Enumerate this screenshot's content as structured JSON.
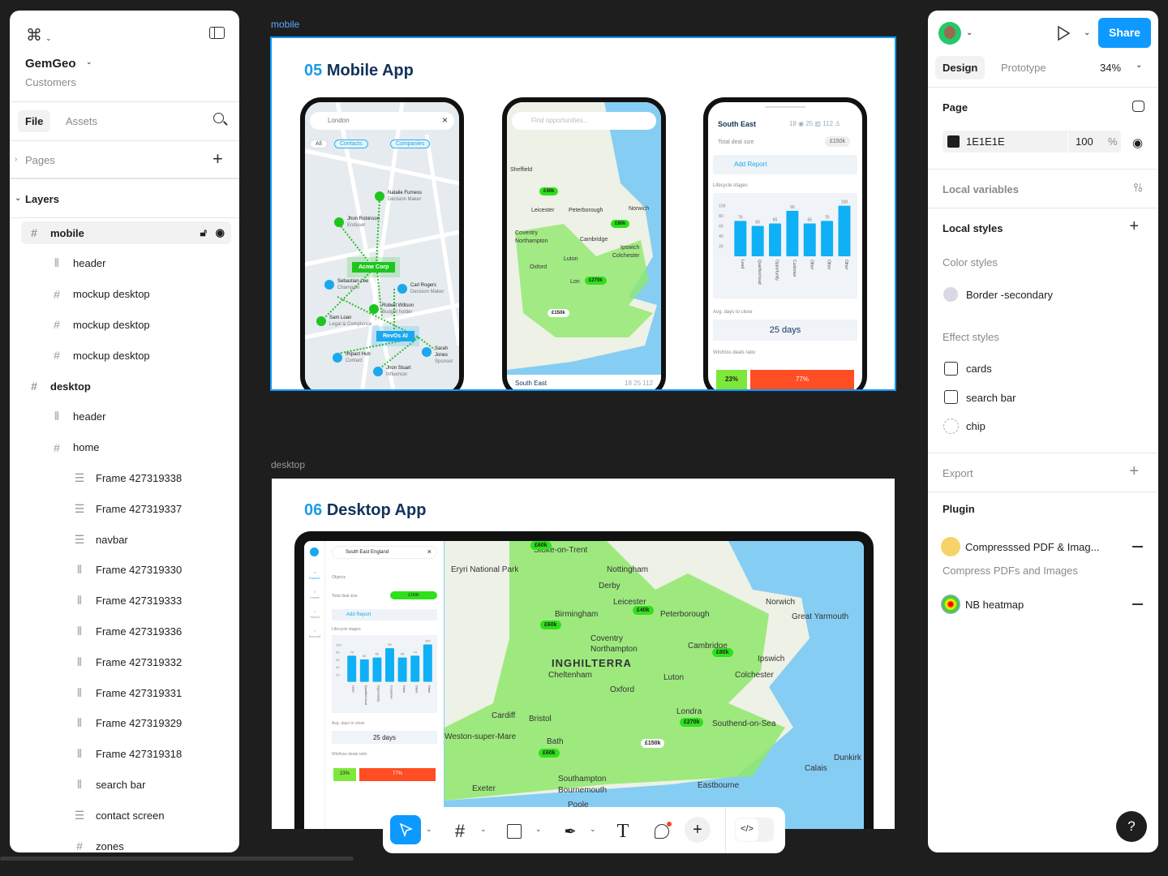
{
  "left_panel": {
    "project_name": "GemGeo",
    "project_sub": "Customers",
    "tabs": [
      "File",
      "Assets"
    ],
    "pages_label": "Pages",
    "layers_label": "Layers",
    "layers": [
      {
        "name": "mobile",
        "icon": "frame-icon",
        "level": 0,
        "selected": true
      },
      {
        "name": "header",
        "icon": "columns-icon",
        "level": 1
      },
      {
        "name": "mockup desktop",
        "icon": "frame-icon",
        "level": 1
      },
      {
        "name": "mockup desktop",
        "icon": "frame-icon",
        "level": 1
      },
      {
        "name": "mockup desktop",
        "icon": "frame-icon",
        "level": 1
      },
      {
        "name": "desktop",
        "icon": "frame-icon",
        "level": 0
      },
      {
        "name": "header",
        "icon": "columns-icon",
        "level": 1
      },
      {
        "name": "home",
        "icon": "frame-icon",
        "level": 1
      },
      {
        "name": "Frame 427319338",
        "icon": "rows-icon",
        "level": 2
      },
      {
        "name": "Frame 427319337",
        "icon": "rows-icon",
        "level": 2
      },
      {
        "name": "navbar",
        "icon": "rows-icon",
        "level": 2
      },
      {
        "name": "Frame 427319330",
        "icon": "columns-icon",
        "level": 2
      },
      {
        "name": "Frame 427319333",
        "icon": "columns-icon",
        "level": 2
      },
      {
        "name": "Frame 427319336",
        "icon": "columns-icon",
        "level": 2
      },
      {
        "name": "Frame 427319332",
        "icon": "columns-icon",
        "level": 2
      },
      {
        "name": "Frame 427319331",
        "icon": "columns-icon",
        "level": 2
      },
      {
        "name": "Frame 427319329",
        "icon": "columns-icon",
        "level": 2
      },
      {
        "name": "Frame 427319318",
        "icon": "columns-icon",
        "level": 2
      },
      {
        "name": "search bar",
        "icon": "columns-icon",
        "level": 2
      },
      {
        "name": "contact screen",
        "icon": "rows-icon",
        "level": 2
      },
      {
        "name": "zones",
        "icon": "frame-icon",
        "level": 2
      }
    ]
  },
  "right_panel": {
    "share_label": "Share",
    "tabs": [
      "Design",
      "Prototype"
    ],
    "zoom": "34%",
    "page_label": "Page",
    "page_color": "1E1E1E",
    "page_color_hex": "#1E1E1E",
    "page_opacity": "100",
    "percent": "%",
    "local_variables": "Local variables",
    "local_styles": "Local styles",
    "color_styles": "Color styles",
    "color_style_items": [
      {
        "name": "Border -secondary",
        "color": "#d9d9e3"
      }
    ],
    "effect_styles": "Effect styles",
    "effect_items": [
      "cards",
      "search bar",
      "chip"
    ],
    "export": "Export",
    "plugin": "Plugin",
    "plugins": [
      {
        "name": "Compresssed PDF & Imag...",
        "desc": "Compress PDFs and Images"
      },
      {
        "name": "NB heatmap",
        "desc": ""
      }
    ]
  },
  "canvas": {
    "mobile_frame_label": "mobile",
    "desktop_frame_label": "desktop",
    "mobile": {
      "num": "05",
      "title": "Mobile App",
      "phone1": {
        "search": "London",
        "chips": [
          "All",
          "Contacts",
          "Companies"
        ],
        "contacts": [
          {
            "name": "Natalie Furness",
            "role": "Decision Maker",
            "color": "green"
          },
          {
            "name": "Jhon Robinson",
            "role": "Enduser",
            "color": "green"
          },
          {
            "name": "Sebastian Lee",
            "role": "Champion",
            "color": "blue"
          },
          {
            "name": "Carl Rogers",
            "role": "Decision Maker",
            "color": "blue"
          },
          {
            "name": "Robert Willson",
            "role": "Budget holder",
            "color": "green"
          },
          {
            "name": "Sam Loan",
            "role": "Legal & Complence",
            "color": "green"
          },
          {
            "name": "Impact Hub",
            "role": "Contact",
            "color": "blue"
          },
          {
            "name": "Jhon Stuart",
            "role": "Influencer",
            "color": "blue"
          },
          {
            "name": "Sarah Jones",
            "role": "Sponsor",
            "color": "blue"
          }
        ],
        "companies": [
          "Acme Corp",
          "RevOs AI"
        ]
      },
      "phone2": {
        "search_placeholder": "Find opportunities...",
        "places": [
          "Sheffield",
          "Leicester",
          "Peterborough",
          "Norwich",
          "Coventry",
          "Northampton",
          "Cambridge",
          "Ipswich",
          "Colchester",
          "Luton",
          "Oxford",
          "Lon"
        ],
        "badges": [
          "£40k",
          "£80k",
          "£270k",
          "£150k"
        ],
        "footer_region": "South East",
        "footer_stats": "18  25  112"
      },
      "phone3": {
        "region": "South East",
        "stats": [
          "18",
          "25",
          "112"
        ],
        "deal_label": "Total deal size",
        "deal_value": "£150k",
        "add_report": "Add Report",
        "lifecycle_label": "Lifecycle stages",
        "avg_label": "Avg. days to close",
        "avg_value": "25 days",
        "ratio_label": "Win/loss deals ratio",
        "win": "23%",
        "loss": "77%",
        "win_fraction": 0.23
      }
    },
    "desktop": {
      "num": "06",
      "title": "Desktop App",
      "search": "South East England",
      "nav": [
        "Explore",
        "Create",
        "Saved",
        "Account"
      ],
      "objects_label": "Objects",
      "deal_label": "Total deal size",
      "deal_value": "£150k",
      "add_report": "Add Report",
      "lifecycle_label": "Lifecycle stages",
      "avg_label": "Avg. days to close",
      "avg_value": "25 days",
      "ratio_label": "Win/loss deals ratio",
      "win": "23%",
      "loss": "77%",
      "places": [
        "Stoke-on-Trent",
        "Nottingham",
        "Derby",
        "Leicester",
        "Birmingham",
        "Peterborough",
        "Norwich",
        "Great Yarmouth",
        "Coventry",
        "Northampton",
        "Cambridge",
        "INGHILTERRA",
        "Ipswich",
        "Cheltenham",
        "Luton",
        "Colchester",
        "Oxford",
        "Londra",
        "Cardiff",
        "Bristol",
        "Southend-on-Sea",
        "Weston-super-Mare",
        "Bath",
        "Southampton",
        "Bournemouth",
        "Poole",
        "Exeter",
        "Eastbourne",
        "Calais",
        "Dunkirk",
        "Eryri National Park"
      ],
      "badges": [
        "£60k",
        "£40k",
        "£60k",
        "£80k",
        "£270k",
        "£150k",
        "£60k"
      ]
    },
    "lifecycle_chart": {
      "type": "bar",
      "categories": [
        "Lead",
        "Qualified lead",
        "Opportunity",
        "Customer",
        "Other",
        "Other",
        "Other"
      ],
      "values": [
        70,
        60,
        65,
        90,
        65,
        70,
        100
      ],
      "yticks": [
        "100",
        "80",
        "60",
        "40",
        "20"
      ],
      "ylim": [
        0,
        100
      ],
      "color": "#0fb0f5"
    }
  },
  "colors": {
    "accent": "#0d99ff",
    "canvas": "#1e1e1e",
    "win": "#7de83a",
    "loss": "#ff4d24",
    "brand_blue": "#1a9be6",
    "brand_navy": "#13325b"
  }
}
